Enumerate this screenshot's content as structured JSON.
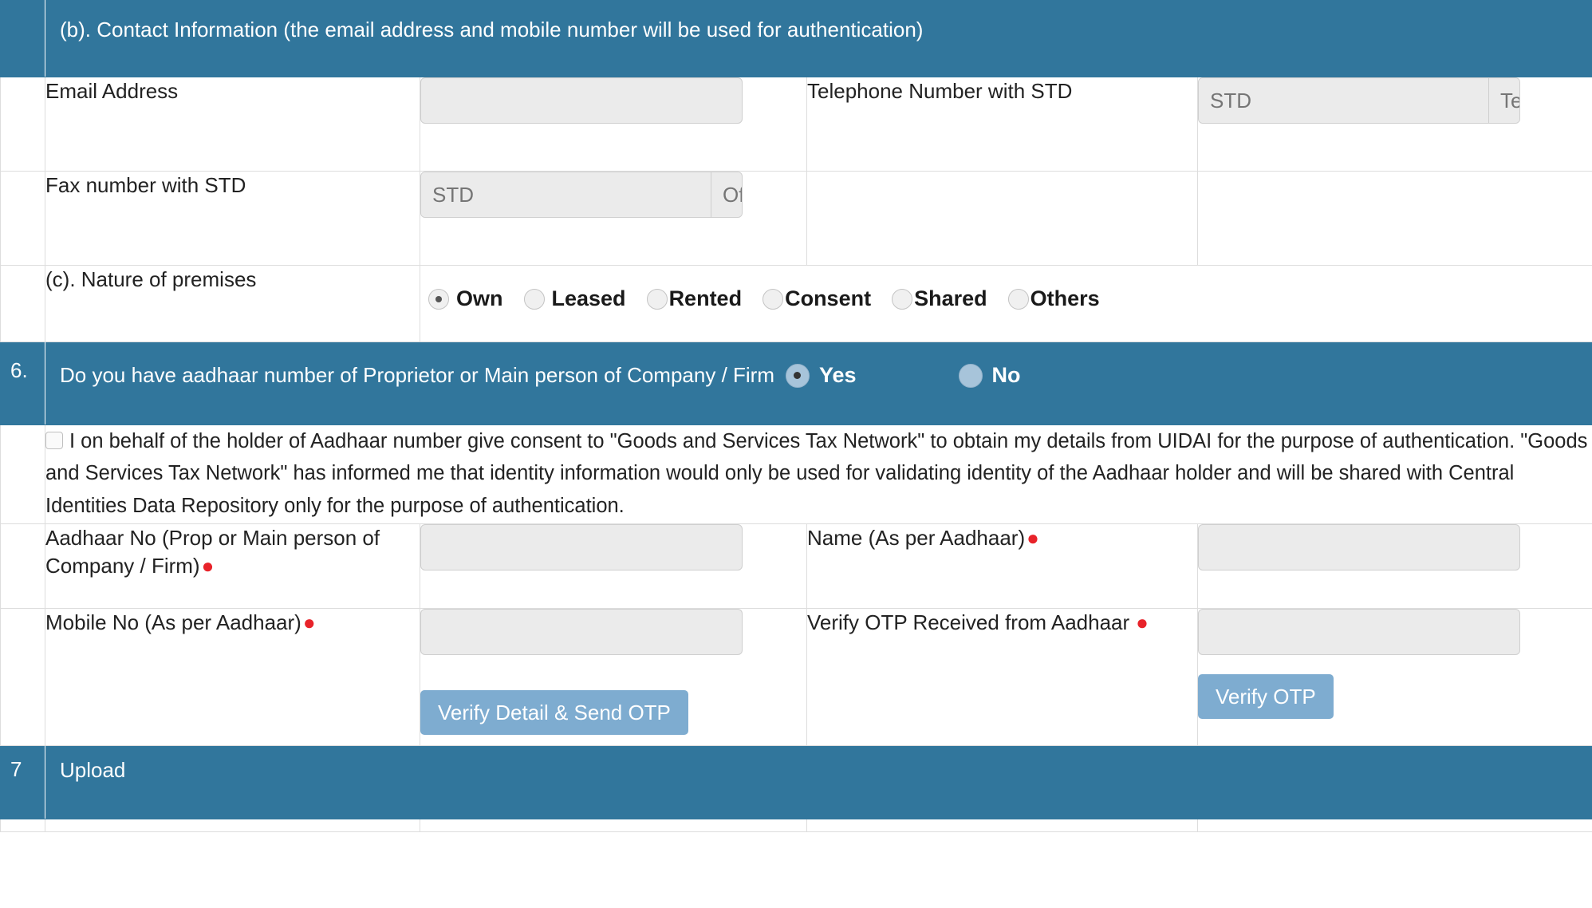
{
  "sections": {
    "contact": {
      "number": "",
      "title": "(b). Contact Information (the email address and mobile number will be used for authentication)"
    },
    "aadhaar_question": {
      "number": "6.",
      "title": "Do you have aadhaar number of Proprietor or Main person of Company / Firm",
      "options": [
        {
          "label": "Yes",
          "selected": true
        },
        {
          "label": "No",
          "selected": false
        }
      ]
    },
    "upload": {
      "number": "7",
      "title": "Upload"
    }
  },
  "rows": {
    "email": {
      "label": "Email Address",
      "input_value": "",
      "input_placeholder": ""
    },
    "telephone": {
      "label": "Telephone Number with STD",
      "std_placeholder": "STD",
      "number_placeholder": "Telephone"
    },
    "fax": {
      "label": "Fax number with STD",
      "std_placeholder": "STD",
      "number_placeholder": "OfficeFax"
    },
    "premises": {
      "label": "(c). Nature of premises",
      "options": [
        {
          "label": "Own",
          "selected": true
        },
        {
          "label": "Leased",
          "selected": false
        },
        {
          "label": "Rented",
          "selected": false
        },
        {
          "label": "Consent",
          "selected": false
        },
        {
          "label": "Shared",
          "selected": false
        },
        {
          "label": "Others",
          "selected": false
        }
      ]
    },
    "consent": {
      "checked": false,
      "text": "I on behalf of the holder of Aadhaar number give consent to \"Goods and Services Tax Network\" to obtain my details from UIDAI for the purpose of authentication. \"Goods and Services Tax Network\" has informed me that identity information would only be used for validating identity of the Aadhaar holder and will be shared with Central Identities Data Repository only for the purpose of authentication."
    },
    "aadhaar_no": {
      "label": "Aadhaar No (Prop or Main person of Company / Firm)",
      "required_marker": "●",
      "input_value": "",
      "input_placeholder": ""
    },
    "name_aadhaar": {
      "label": "Name (As per Aadhaar)",
      "required_marker": "●",
      "input_value": "",
      "input_placeholder": ""
    },
    "mobile_aadhaar": {
      "label": "Mobile No (As per Aadhaar)",
      "required_marker": "●",
      "input_value": "",
      "input_placeholder": ""
    },
    "verify_otp_field": {
      "label": "Verify OTP Received from Aadhaar",
      "required_marker": "●",
      "input_value": "",
      "input_placeholder": ""
    }
  },
  "buttons": {
    "verify_detail_send_otp": "Verify Detail & Send OTP",
    "verify_otp": "Verify OTP"
  },
  "colors": {
    "header_blue": "#31769c",
    "button_blue": "#7eacd0",
    "required_red": "#e8232a",
    "input_grey": "#ebebeb",
    "border_grey": "#dddddd"
  }
}
